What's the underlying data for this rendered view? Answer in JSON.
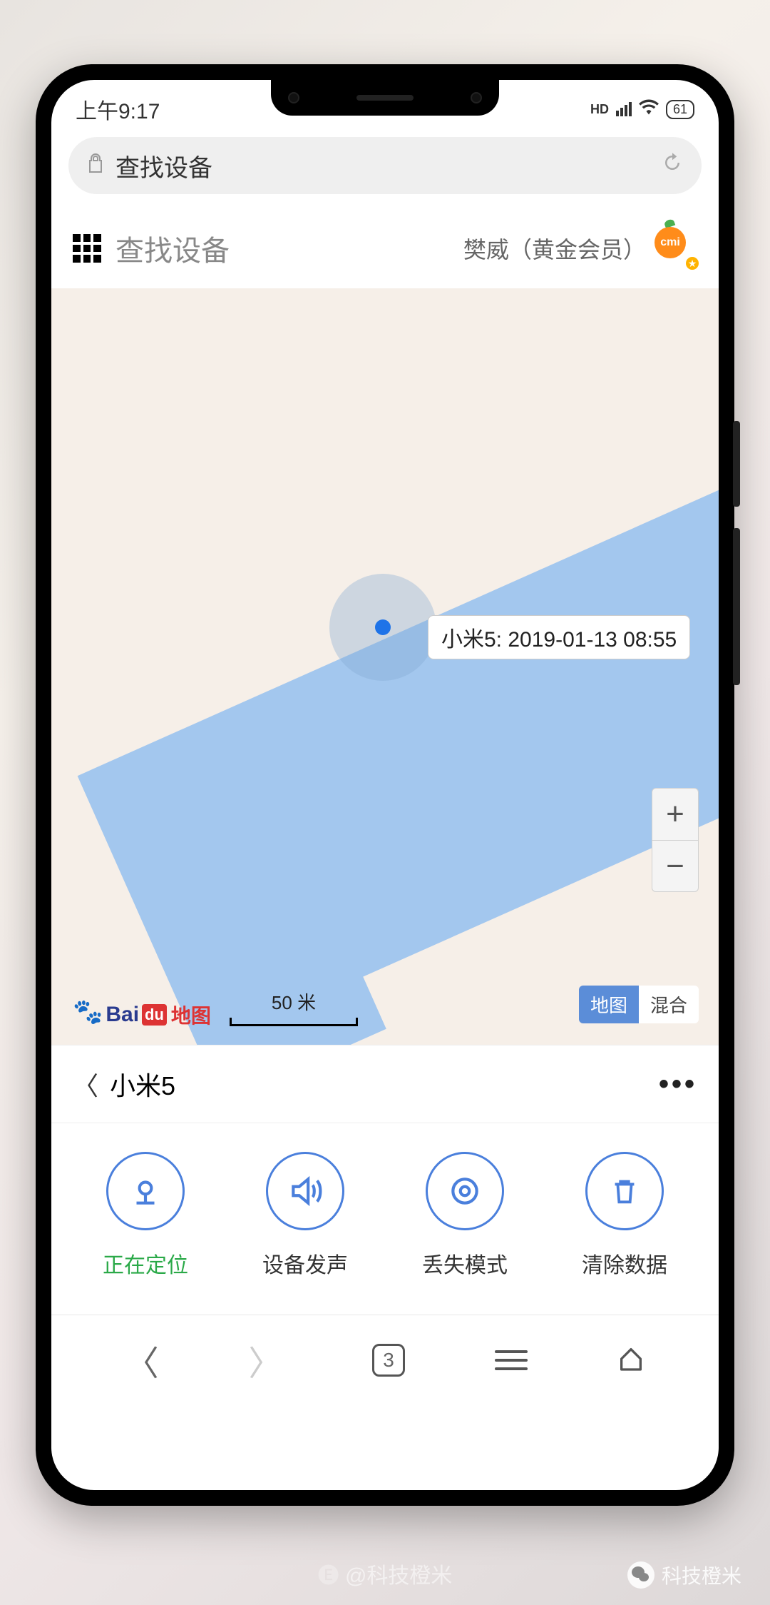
{
  "status": {
    "time": "上午9:17",
    "hd": "HD",
    "battery": "61"
  },
  "addressBar": {
    "title": "查找设备"
  },
  "appHeader": {
    "title": "查找设备",
    "user": "樊威（黄金会员）",
    "avatarText": "cmi"
  },
  "map": {
    "callout": "小米5: 2019-01-13 08:55",
    "scale": "50 米",
    "layerActive": "地图",
    "layerOther": "混合",
    "logoSuffix": "地图"
  },
  "deviceBar": {
    "name": "小米5"
  },
  "actions": {
    "locate": "正在定位",
    "sound": "设备发声",
    "lost": "丢失模式",
    "erase": "清除数据"
  },
  "bottomNav": {
    "tabCount": "3"
  },
  "watermark": {
    "center": "@科技橙米",
    "right": "科技橙米"
  }
}
